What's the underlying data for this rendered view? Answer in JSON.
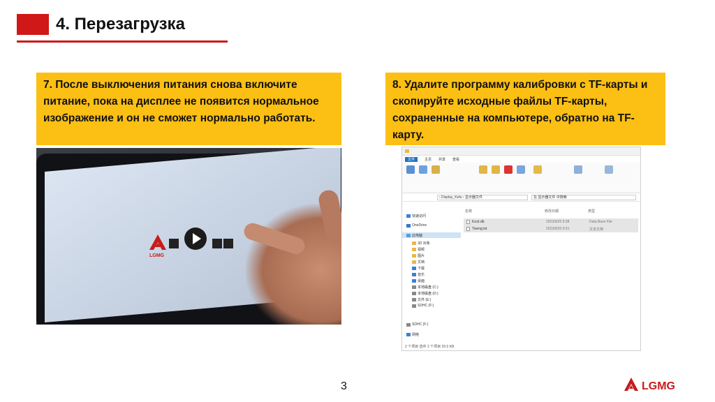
{
  "slide": {
    "title": "4. Перезагрузка",
    "page_number": "3",
    "brand": "LGMG"
  },
  "step7": {
    "text": "7. После выключения питания снова включите питание, пока на дисплее не появится нормальное изображение и он не сможет нормально работать."
  },
  "step8": {
    "text": "8. Удалите программу калибровки с TF-карты и скопируйте исходные файлы TF-карты, сохраненные на компьютере, обратно на TF-карту."
  },
  "tablet_screen": {
    "logo_text": "LGMG"
  },
  "explorer": {
    "tabs": [
      "文件",
      "主页",
      "共享",
      "查看"
    ],
    "address": "› Display_Kefu › 显示器文件",
    "search_placeholder": "在 显示器文件 中搜索",
    "columns": [
      "名称",
      "修改日期",
      "类型"
    ],
    "nav": [
      "快速访问",
      "OneDrive",
      "此电脑",
      "3D 对象",
      "视频",
      "图片",
      "文档",
      "下载",
      "音乐",
      "桌面",
      "本地磁盘 (C:)",
      "本地磁盘 (D:)",
      "文件 (E:)",
      "SDHC (F:)",
      "SDHC (F:)",
      "网络"
    ],
    "files": [
      {
        "name": "fccnt.db",
        "date": "2023/9/20 9:38",
        "type": "Data Base File"
      },
      {
        "name": "Tweng.txt",
        "date": "2023/9/20 9:31",
        "type": "文本文档"
      }
    ],
    "status": "2 个项目   选中 2 个项目 29.0 KB"
  },
  "colors": {
    "accent_red": "#d01818",
    "callout_yellow": "#fcbf13"
  }
}
